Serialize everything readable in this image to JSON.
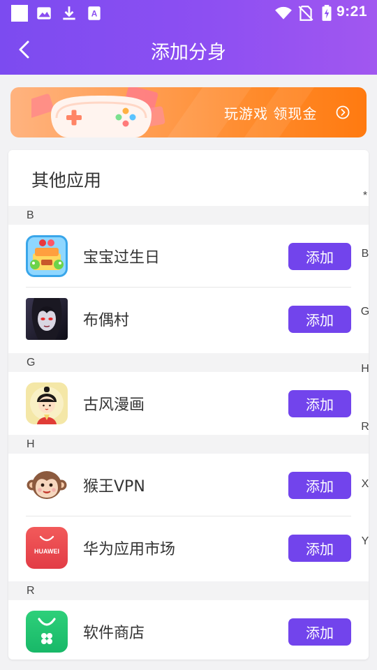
{
  "status_bar": {
    "time": "9:21",
    "left_icons": [
      "notification-square",
      "image-icon",
      "download-icon",
      "font-app-icon"
    ],
    "right_icons": [
      "wifi-icon",
      "no-sim-icon",
      "battery-charging-icon"
    ]
  },
  "header": {
    "title": "添加分身",
    "back_icon": "chevron-left-icon"
  },
  "banner": {
    "text": "玩游戏 领现金",
    "icon": "chevron-right-circle-icon"
  },
  "card": {
    "title": "其他应用",
    "sections": [
      {
        "letter": "B",
        "apps": [
          {
            "name": "宝宝过生日",
            "button": "添加"
          },
          {
            "name": "布偶村",
            "button": "添加"
          }
        ]
      },
      {
        "letter": "G",
        "apps": [
          {
            "name": "古风漫画",
            "button": "添加"
          }
        ]
      },
      {
        "letter": "H",
        "apps": [
          {
            "name": "猴王VPN",
            "button": "添加"
          },
          {
            "name": "华为应用市场",
            "button": "添加"
          }
        ]
      },
      {
        "letter": "R",
        "apps": [
          {
            "name": "软件商店",
            "button": "添加"
          }
        ]
      }
    ]
  },
  "huawei_icon_text": "HUAWEI",
  "index_bar": [
    "*",
    "B",
    "G",
    "H",
    "R",
    "X",
    "Y"
  ],
  "colors": {
    "accent": "#7244ec",
    "header_gradient_start": "#7c4bf0",
    "header_gradient_end": "#a157f0",
    "banner_start": "#ffb37f",
    "banner_end": "#ff7a10"
  }
}
